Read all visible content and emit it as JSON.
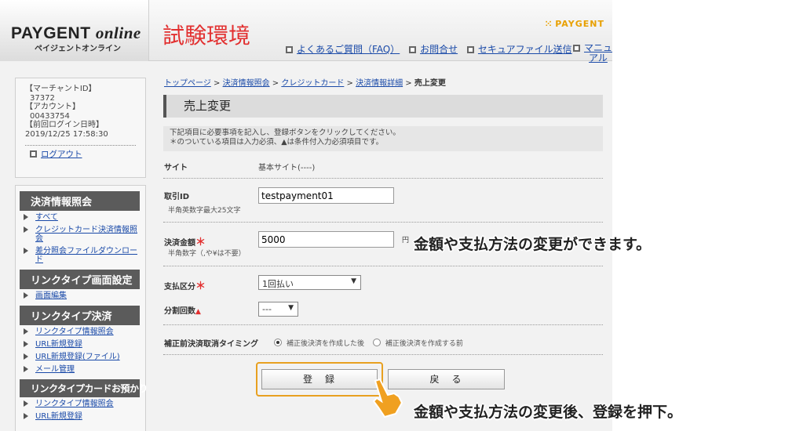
{
  "header": {
    "logo_main": "PAYGENT",
    "logo_italic": "online",
    "logo_sub": "ペイジェントオンライン",
    "env_label": "試験環境",
    "brand": "PAYGENT",
    "links": [
      {
        "label": "よくあるご質問（FAQ）"
      },
      {
        "label": "お問合せ"
      },
      {
        "label": "セキュアファイル送信"
      }
    ],
    "manual_line1": "マニュ",
    "manual_line2": "アル"
  },
  "account": {
    "merchant_label": "【マーチャントID】",
    "merchant_id": "37372",
    "account_label": "【アカウント】",
    "account_id": "00433754",
    "last_login_label": "【前回ログイン日時】",
    "last_login": "2019/12/25 17:58:30",
    "logout": "ログアウト"
  },
  "nav": {
    "groups": [
      {
        "title": "決済情報照会",
        "items": [
          "すべて",
          "クレジットカード決済情報照会",
          "差分照会ファイルダウンロード"
        ]
      },
      {
        "title": "リンクタイプ画面設定",
        "items": [
          "画面編集"
        ]
      },
      {
        "title": "リンクタイプ決済",
        "items": [
          "リンクタイプ情報照会",
          "URL新規登録",
          "URL新規登録(ファイル)",
          "メール管理"
        ]
      },
      {
        "title": "リンクタイプカードお預かり",
        "items": [
          "リンクタイプ情報照会",
          "URL新規登録"
        ]
      }
    ]
  },
  "breadcrumb": {
    "items": [
      "トップページ",
      "決済情報照会",
      "クレジットカード",
      "決済情報詳細"
    ],
    "sep": ">",
    "current": "売上変更"
  },
  "page_title": "売上変更",
  "instructions": {
    "line1": "下記項目に必要事項を記入し、登録ボタンをクリックしてください。",
    "line2": "＊のついている項目は入力必須、▲は条件付入力必須項目です。"
  },
  "form": {
    "site_label": "サイト",
    "site_value": "基本サイト(----)",
    "txn_label": "取引ID",
    "txn_note": "半角英数字最大25文字",
    "txn_value": "testpayment01",
    "amount_label": "決済金額",
    "amount_note": "半角数字（,や¥は不要）",
    "amount_value": "5000",
    "amount_unit": "円",
    "method_label": "支払区分",
    "method_value": "1回払い",
    "split_label": "分割回数",
    "split_value": "---",
    "timing_label": "補正前決済取消タイミング",
    "timing_opt1": "補正後決済を作成した後",
    "timing_opt2": "補正後決済を作成する前",
    "required_mark": "＊",
    "conditional_mark": "▲"
  },
  "buttons": {
    "register": "登　録",
    "back": "戻　る"
  },
  "callouts": {
    "top": "金額や支払方法の変更ができます。",
    "bottom": "金額や支払方法の変更後、登録を押下。"
  },
  "colors": {
    "accent": "#e8a020",
    "env_red": "#e23030",
    "link_blue": "#1a4aa8"
  }
}
